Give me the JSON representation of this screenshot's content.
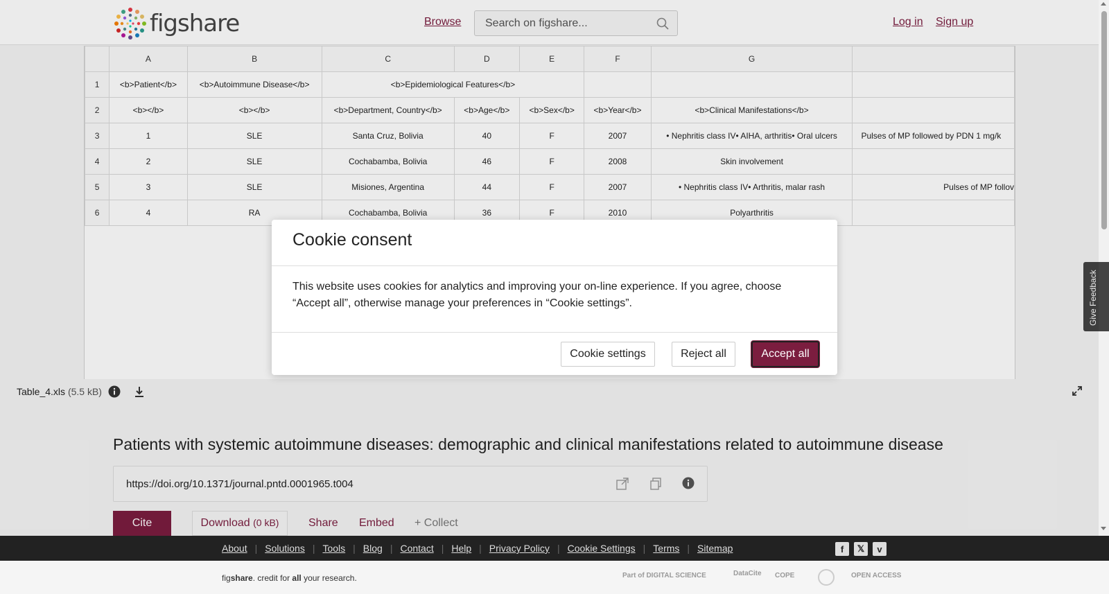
{
  "header": {
    "logo_text": "figshare",
    "browse": "Browse",
    "search_placeholder": "Search on figshare...",
    "login": "Log in",
    "signup": "Sign up"
  },
  "spreadsheet": {
    "columns": [
      "A",
      "B",
      "C",
      "D",
      "E",
      "F",
      "G",
      ""
    ],
    "rows": [
      {
        "num": "1",
        "cells": [
          "<b>Patient</b>",
          "<b>Autoimmune Disease</b>",
          "<b>Epidemiological Features</b>",
          "",
          "",
          "",
          ""
        ]
      },
      {
        "num": "2",
        "cells": [
          "<b></b>",
          "<b></b>",
          "<b>Department, Country</b>",
          "<b>Age</b>",
          "<b>Sex</b>",
          "<b>Year</b>",
          "<b>Clinical Manifestations</b>",
          ""
        ]
      },
      {
        "num": "3",
        "cells": [
          "1",
          "SLE",
          "Santa Cruz, Bolivia",
          "40",
          "F",
          "2007",
          "• Nephritis class IV• AIHA, arthritis• Oral ulcers",
          "Pulses of MP followed by PDN 1 mg/k"
        ]
      },
      {
        "num": "4",
        "cells": [
          "2",
          "SLE",
          "Cochabamba, Bolivia",
          "46",
          "F",
          "2008",
          "Skin involvement",
          ""
        ]
      },
      {
        "num": "5",
        "cells": [
          "3",
          "SLE",
          "Misiones, Argentina",
          "44",
          "F",
          "2007",
          "• Nephritis class IV• Arthritis, malar rash",
          "Pulses of MP follov"
        ]
      },
      {
        "num": "6",
        "cells": [
          "4",
          "RA",
          "Cochabamba, Bolivia",
          "36",
          "F",
          "2010",
          "Polyarthritis",
          ""
        ]
      }
    ]
  },
  "file": {
    "name": "Table_4.xls",
    "size": "(5.5 kB)"
  },
  "item": {
    "title": "Patients with systemic autoimmune diseases: demographic and clinical manifestations related to autoimmune disease",
    "doi": "https://doi.org/10.1371/journal.pntd.0001965.t004",
    "cite": "Cite",
    "download": "Download",
    "download_size": "(0 kB)",
    "share": "Share",
    "embed": "Embed",
    "collect": "+ Collect"
  },
  "feedback": "Give Feedback",
  "footer": {
    "links": [
      "About",
      "Solutions",
      "Tools",
      "Blog",
      "Contact",
      "Help",
      "Privacy Policy",
      "Cookie Settings",
      "Terms",
      "Sitemap"
    ],
    "credit_pre": "fig",
    "credit_bold": "share",
    "credit_mid": ". credit for ",
    "credit_all": "all",
    "credit_post": " your research.",
    "partners": [
      "Part of DIGITAL SCIENCE",
      "DataCite",
      "COPE",
      "",
      "OPEN ACCESS"
    ]
  },
  "cookie_modal": {
    "title": "Cookie consent",
    "body": "This website uses cookies for analytics and improving your on-line experience. If you agree, choose “Accept all”, otherwise manage your preferences in “Cookie settings”.",
    "settings": "Cookie settings",
    "reject": "Reject all",
    "accept": "Accept all"
  },
  "colors": {
    "brand": "#7b1d3f",
    "footer_bg": "#222222"
  }
}
